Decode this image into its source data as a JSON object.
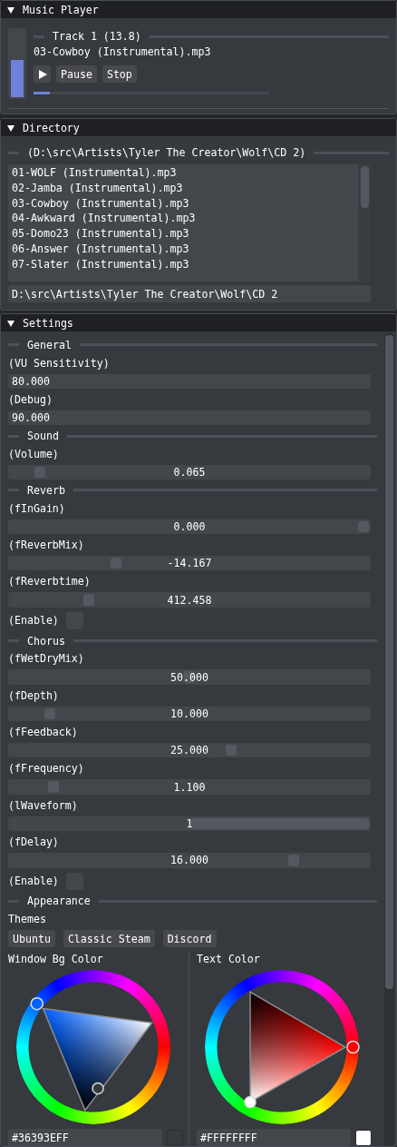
{
  "music_player": {
    "title": "Music Player",
    "expanded": true,
    "vu_meter": {
      "level": 0.55
    },
    "track": {
      "label": "Track 1 (13.8)",
      "file": "03-Cowboy (Instrumental).mp3"
    },
    "buttons": [
      "Pause",
      "Stop"
    ],
    "progress": {
      "level": 0.07
    }
  },
  "directory": {
    "title": "Directory",
    "expanded": true,
    "path_label": "(D:\\src\\Artists\\Tyler The Creator\\Wolf\\CD 2)",
    "files": [
      "01-WOLF (Instrumental).mp3",
      "02-Jamba (Instrumental).mp3",
      "03-Cowboy (Instrumental).mp3",
      "04-Awkward (Instrumental).mp3",
      "05-Domo23 (Instrumental).mp3",
      "06-Answer (Instrumental).mp3",
      "07-Slater (Instrumental).mp3"
    ],
    "path_field": {
      "value": "D:\\src\\Artists\\Tyler The Creator\\Wolf\\CD 2"
    }
  },
  "settings": {
    "title": "Settings",
    "expanded": true,
    "sections": [
      {
        "title": "General",
        "items": [
          {
            "kind": "input",
            "label": "(VU Sensitivity)",
            "value": "80.000"
          },
          {
            "kind": "input",
            "label": "(Debug)",
            "value": "90.000"
          }
        ]
      },
      {
        "title": "Sound",
        "items": [
          {
            "kind": "slider",
            "label": "(Volume)",
            "value": "0.065",
            "level": 0.07
          }
        ]
      },
      {
        "title": "Reverb",
        "items": [
          {
            "kind": "slider",
            "label": "(fInGain)",
            "value": "0.000",
            "level": 1
          },
          {
            "kind": "slider",
            "label": "(fReverbMix)",
            "value": "-14.167",
            "level": 0.29
          },
          {
            "kind": "slider",
            "label": "(fReverbtime)",
            "value": "412.458",
            "level": 0.21
          },
          {
            "kind": "checkbox",
            "label": "(Enable)",
            "checked": false
          }
        ]
      },
      {
        "title": "Chorus",
        "items": [
          {
            "kind": "slider",
            "label": "(fWetDryMix)",
            "value": "50.000",
            "level": 0.5
          },
          {
            "kind": "slider",
            "label": "(fDepth)",
            "value": "10.000",
            "level": 0.1
          },
          {
            "kind": "slider",
            "label": "(fFeedback)",
            "value": "25.000",
            "level": 0.62
          },
          {
            "kind": "slider",
            "label": "(fFrequency)",
            "value": "1.100",
            "level": 0.11
          },
          {
            "kind": "int_slider",
            "label": "(lWaveform)",
            "value": "1",
            "level": 1
          },
          {
            "kind": "slider",
            "label": "(fDelay)",
            "value": "16.000",
            "level": 0.8
          },
          {
            "kind": "checkbox",
            "label": "(Enable)",
            "checked": false
          }
        ]
      }
    ],
    "appearance": {
      "title": "Appearance",
      "themes_label": "Themes",
      "themes": [
        "Ubuntu",
        "Classic Steam",
        "Discord"
      ],
      "pickers": [
        {
          "label": "Window Bg Color",
          "value": "#36393EFF",
          "color": "#36393e"
        },
        {
          "label": "Text Color",
          "value": "#FFFFFFFF",
          "color": "#ffffff"
        }
      ]
    }
  }
}
